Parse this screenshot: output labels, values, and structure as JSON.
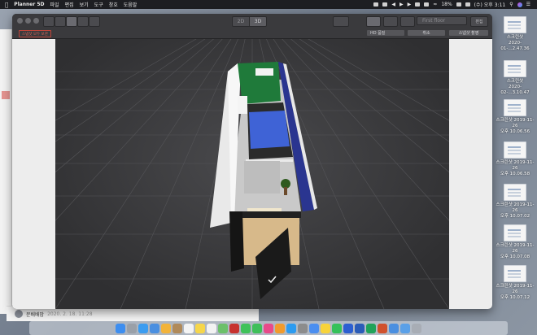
{
  "menubar": {
    "app_name": "Planner 5D",
    "menus": [
      "파일",
      "편집",
      "보기",
      "도구",
      "창호",
      "도움말"
    ],
    "battery": "18%",
    "clock": "(수) 오후 3:11"
  },
  "toolbar": {
    "view_2d": "2D",
    "view_3d": "3D",
    "floor_select": "First floor",
    "settings_label": "편집"
  },
  "subbar": {
    "tag_text": "스냅샷 모두 보관",
    "quality_select": "HD 품질",
    "cancel_label": "취소",
    "snapshot_label": "스냅샷 촬영"
  },
  "background_app": {
    "user_name": "문배배맘",
    "timestamp": "2020. 2. 18. 11:28"
  },
  "desktop_icons": [
    {
      "line1": "스크린샷",
      "line2": "2020-01-...2.47.36"
    },
    {
      "line1": "스크린샷",
      "line2": "2020-02-...3.10.47"
    },
    {
      "line1": "스크린샷 2019-11-26",
      "line2": "오후 10.06.56"
    },
    {
      "line1": "스크린샷 2019-11-26",
      "line2": "오후 10.06.58"
    },
    {
      "line1": "스크린샷 2019-11-26",
      "line2": "오후 10.07.02"
    },
    {
      "line1": "스크린샷 2019-11-26",
      "line2": "오후 10.07.08"
    },
    {
      "line1": "스크린샷 2019-11-26",
      "line2": "오후 10.07.12"
    }
  ],
  "colors": {
    "window_bg": "#2e2e30",
    "toolbar_bg": "#3a3a3d",
    "viewport_bg": "#3b3b3d",
    "wall_green": "#1f7a3a",
    "wall_blue": "#2a3590",
    "bed_blue": "#3f63d6",
    "floor_tan": "#d7b98a",
    "accent_red": "#c0453a"
  },
  "dock_icons": [
    "finder-icon",
    "launchpad-icon",
    "safari-icon",
    "mail-icon",
    "photos-icon",
    "contacts-icon",
    "calendar-icon",
    "notes-icon",
    "reminders-icon",
    "maps-icon",
    "photo-booth-icon",
    "messages-icon",
    "facetime-icon",
    "itunes-icon",
    "ibooks-icon",
    "app-store-icon",
    "preferences-icon",
    "chrome-icon",
    "kakaotalk-icon",
    "line-icon",
    "planner5d-icon",
    "word-icon",
    "excel-icon",
    "powerpoint-icon",
    "finder-window-icon",
    "downloads-icon",
    "trash-icon"
  ]
}
